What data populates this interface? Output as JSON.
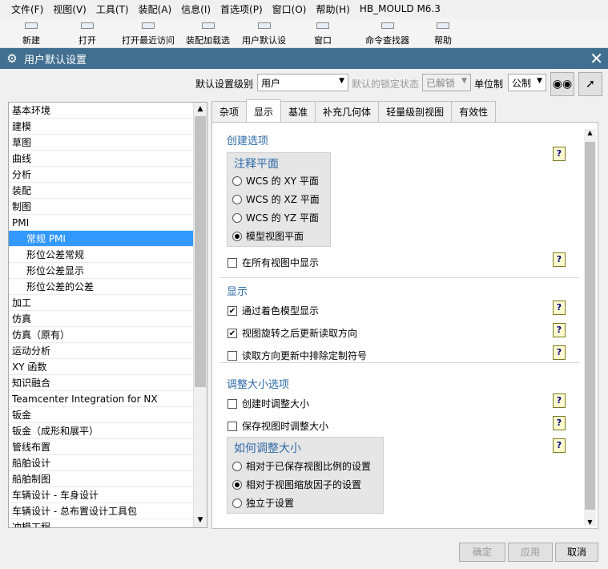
{
  "menubar": {
    "items": [
      "文件(F)",
      "视图(V)",
      "工具(T)",
      "装配(A)",
      "信息(I)",
      "首选项(P)",
      "窗口(O)",
      "帮助(H)",
      "HB_MOULD M6.3"
    ]
  },
  "toolbar": {
    "items": [
      "新建",
      "打开",
      "打开最近访问",
      "装配加载选",
      "用户默认设",
      "窗口",
      "命令查找器",
      "帮助"
    ]
  },
  "dialog": {
    "title": "用户默认设置",
    "level_label": "默认设置级别",
    "level_value": "用户",
    "lock_label": "默认的锁定状态",
    "lock_value": "已解锁",
    "unit_label": "单位制",
    "unit_value": "公制"
  },
  "tree": {
    "items": [
      "基本环境",
      "建模",
      "草图",
      "曲线",
      "分析",
      "装配",
      "制图",
      "PMI",
      "常规 PMI",
      "形位公差常规",
      "形位公差显示",
      "形位公差的公差",
      "加工",
      "仿真",
      "仿真（原有）",
      "运动分析",
      "XY 函数",
      "知识融合",
      "Teamcenter Integration for NX",
      "钣金",
      "钣金（成形和展平）",
      "管线布置",
      "船舶设计",
      "船舶制图",
      "车辆设计 - 车身设计",
      "车辆设计 - 总布置设计工具包",
      "冲模工程"
    ]
  },
  "tabs": [
    "杂项",
    "显示",
    "基准",
    "补充几何体",
    "轻量级剖视图",
    "有效性"
  ],
  "sections": {
    "create": {
      "title": "创建选项",
      "group_title": "注释平面",
      "options": [
        "WCS 的 XY 平面",
        "WCS 的 XZ 平面",
        "WCS 的 YZ 平面",
        "模型视图平面"
      ],
      "selected": "模型视图平面",
      "check_all_views": "在所有视图中显示"
    },
    "display": {
      "title": "显示",
      "checks": [
        "通过着色模型显示",
        "视图旋转之后更新读取方向",
        "读取方向更新中排除定制符号"
      ],
      "checked": [
        true,
        true,
        false
      ]
    },
    "resize": {
      "title": "调整大小选项",
      "checks": [
        "创建时调整大小",
        "保存视图时调整大小"
      ],
      "group_title": "如何调整大小",
      "options": [
        "相对于已保存视图比例的设置",
        "相对于视图缩放因子的设置",
        "独立于设置"
      ],
      "selected": "相对于视图缩放因子的设置"
    }
  },
  "help_glyph": "?",
  "buttons": {
    "ok": "确定",
    "apply": "应用",
    "cancel": "取消"
  },
  "colors": {
    "titlebar": "#416f8f",
    "section_title": "#2d6aa8",
    "selection": "#3399ff"
  }
}
